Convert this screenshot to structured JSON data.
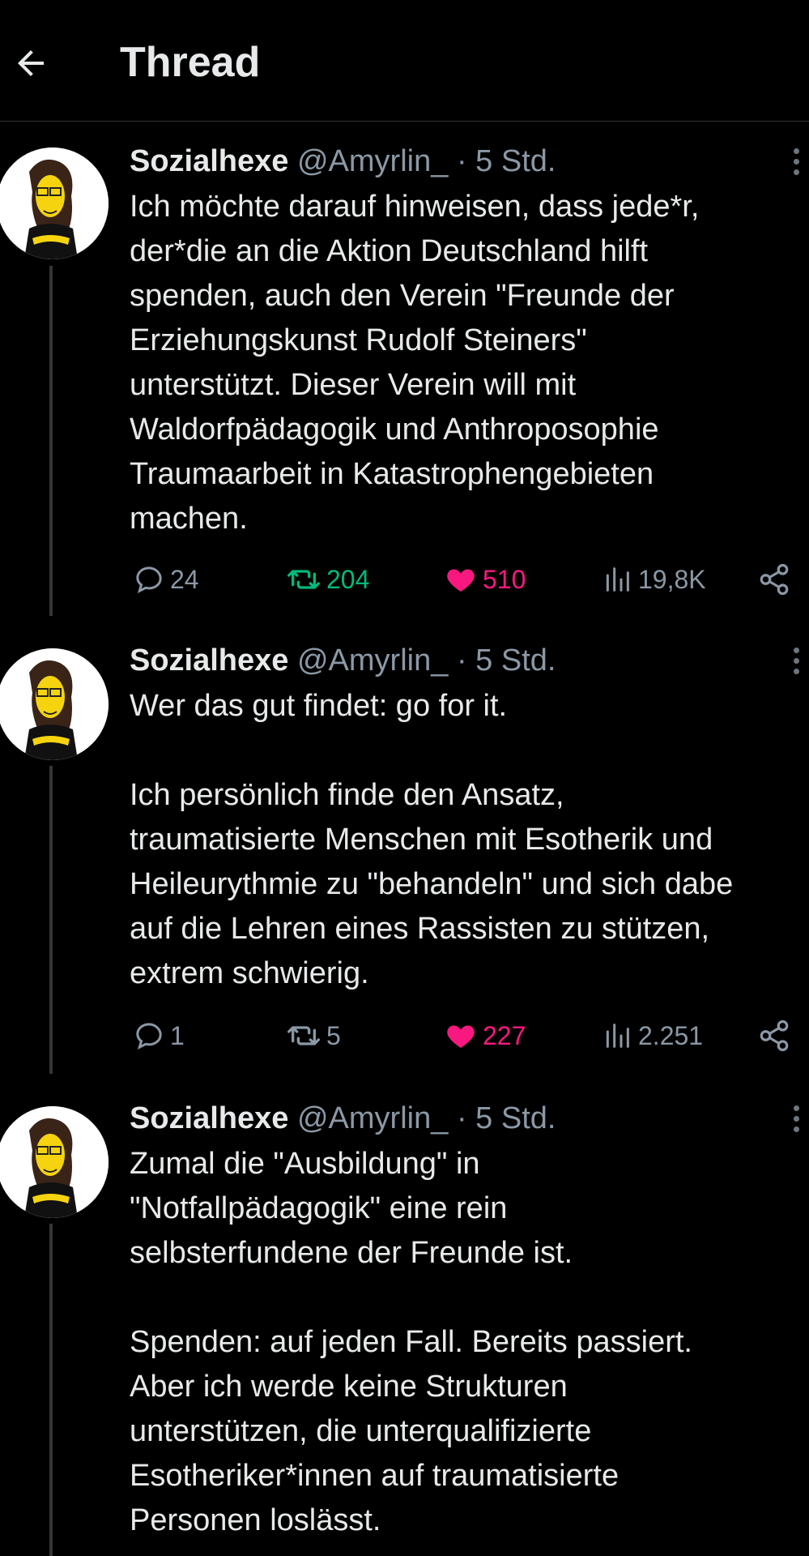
{
  "header": {
    "title": "Thread",
    "back_icon": "arrow-left-icon"
  },
  "colors": {
    "background": "#000000",
    "text": "#e7e9ea",
    "muted": "#8b98a5",
    "retweet_active": "#00ba7c",
    "like_active": "#f91880"
  },
  "tweets": [
    {
      "author_name": "Sozialhexe",
      "handle": "@Amyrlin_",
      "separator": "·",
      "time": "5 Std.",
      "text": "Ich möchte darauf hinweisen, dass jede*r,\nder*die an die Aktion Deutschland hilft\nspenden, auch den Verein \"Freunde der\nErziehungskunst Rudolf Steiners\"\nunterstützt. Dieser Verein will mit\nWaldorfpädagogik und Anthroposophie\nTraumaarbeit in Katastrophengebieten\nmachen.",
      "replies": "24",
      "retweets": "204",
      "likes": "510",
      "views": "19,8K",
      "retweeted": true,
      "liked": true
    },
    {
      "author_name": "Sozialhexe",
      "handle": "@Amyrlin_",
      "separator": "·",
      "time": "5 Std.",
      "text": "Wer das gut findet: go for it.\n\nIch persönlich finde den Ansatz,\ntraumatisierte Menschen mit Esotherik und\nHeileurythmie zu \"behandeln\" und sich dabe\nauf die Lehren eines Rassisten zu stützen,\nextrem schwierig.",
      "replies": "1",
      "retweets": "5",
      "likes": "227",
      "views": "2.251",
      "retweeted": false,
      "liked": true
    },
    {
      "author_name": "Sozialhexe",
      "handle": "@Amyrlin_",
      "separator": "·",
      "time": "5 Std.",
      "text": "Zumal die \"Ausbildung\" in\n\"Notfallpädagogik\" eine rein\nselbsterfundene der Freunde ist.\n\nSpenden: auf jeden Fall. Bereits passiert.\nAber ich werde keine Strukturen\nunterstützen, die unterqualifizierte\nEsotheriker*innen auf traumatisierte\nPersonen loslässt."
    }
  ]
}
